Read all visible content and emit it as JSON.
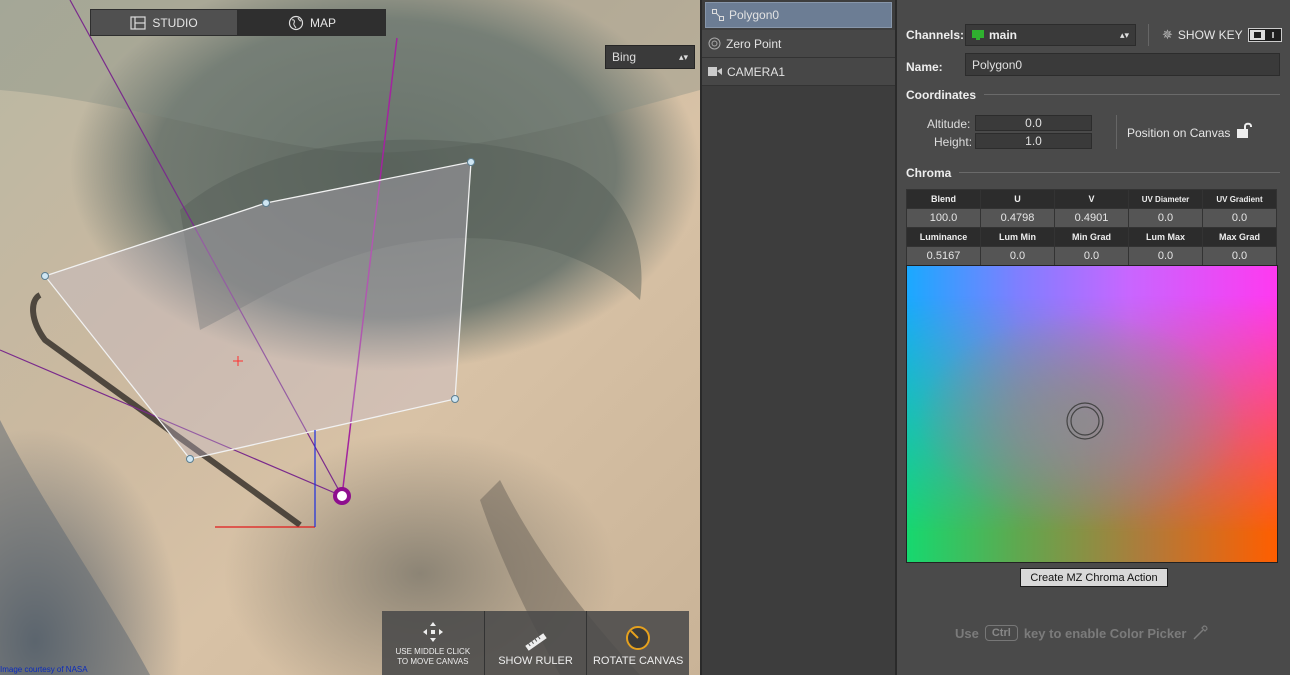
{
  "map": {
    "tabs": [
      {
        "label": "STUDIO",
        "icon": "studio-icon",
        "active": false
      },
      {
        "label": "MAP",
        "icon": "globe-icon",
        "active": true
      }
    ],
    "provider": "Bing",
    "credit": "Image courtesy of NASA",
    "tools": {
      "move_line1": "USE MIDDLE CLICK",
      "move_line2": "TO MOVE CANVAS",
      "ruler": "SHOW RULER",
      "rotate": "ROTATE CANVAS"
    }
  },
  "outliner": {
    "items": [
      {
        "label": "Polygon0",
        "icon": "polygon-icon",
        "selected": true
      },
      {
        "label": "Zero Point",
        "icon": "zero-point-icon",
        "selected": false
      },
      {
        "label": "CAMERA1",
        "icon": "camera-icon",
        "selected": false
      }
    ]
  },
  "props": {
    "channels_label": "Channels:",
    "channel_value": "main",
    "show_key": "SHOW KEY",
    "name_label": "Name:",
    "name_value": "Polygon0",
    "coordinates_head": "Coordinates",
    "altitude_label": "Altitude:",
    "altitude_value": "0.0",
    "height_label": "Height:",
    "height_value": "1.0",
    "position_on_canvas": "Position on Canvas",
    "chroma_head": "Chroma",
    "chroma_headers1": [
      "Blend",
      "U",
      "V",
      "UV Diameter",
      "UV Gradient"
    ],
    "chroma_values1": [
      "100.0",
      "0.4798",
      "0.4901",
      "0.0",
      "0.0"
    ],
    "chroma_headers2": [
      "Luminance",
      "Lum Min",
      "Min Grad",
      "Lum Max",
      "Max Grad"
    ],
    "chroma_values2": [
      "0.5167",
      "0.0",
      "0.0",
      "0.0",
      "0.0"
    ],
    "create_action": "Create MZ Chroma Action",
    "hint_use": "Use",
    "hint_key": "Ctrl",
    "hint_rest": "key to enable Color Picker"
  },
  "colors": {
    "accent_selected": "#6c7d94",
    "channel_green": "#2fb12f",
    "camera_ring": "#8e0e8e"
  }
}
